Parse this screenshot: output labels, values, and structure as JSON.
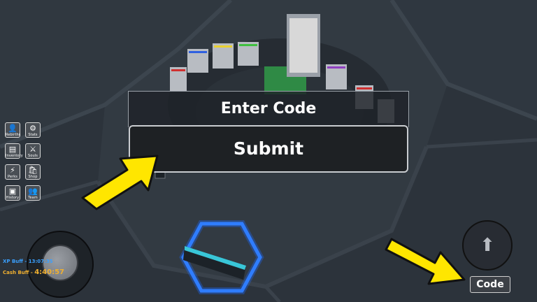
{
  "side_menu": [
    {
      "label": "Rebirths",
      "icon": "person-icon",
      "glyph": "👤"
    },
    {
      "label": "Stats",
      "icon": "gear-icon",
      "glyph": "⚙"
    },
    {
      "label": "Inventory",
      "icon": "backpack-icon",
      "glyph": "▤"
    },
    {
      "label": "Souls",
      "icon": "sword-icon",
      "glyph": "⚔"
    },
    {
      "label": "Perks",
      "icon": "lightning-icon",
      "glyph": "⚡"
    },
    {
      "label": "Shop",
      "icon": "shopping-bag-icon",
      "glyph": "🛍"
    },
    {
      "label": "History",
      "icon": "clipboard-icon",
      "glyph": "▣"
    },
    {
      "label": "Team",
      "icon": "group-icon",
      "glyph": "👥"
    }
  ],
  "code_dialog": {
    "title": "Enter Code",
    "submit_label": "Submit"
  },
  "buffs": [
    {
      "label": "XP Buff -",
      "time": "13:07:35",
      "color": "#3aa0ff"
    },
    {
      "label": "Cash Buff -",
      "time": "4:40:57",
      "color": "#f0b030"
    }
  ],
  "jump_button": {
    "icon": "up-arrow-icon",
    "glyph": "⬆"
  },
  "code_button": {
    "label": "Code"
  },
  "colors": {
    "arrow": "#ffe600",
    "hexagon": "#1e6bff",
    "pad": "#2f8a45"
  }
}
